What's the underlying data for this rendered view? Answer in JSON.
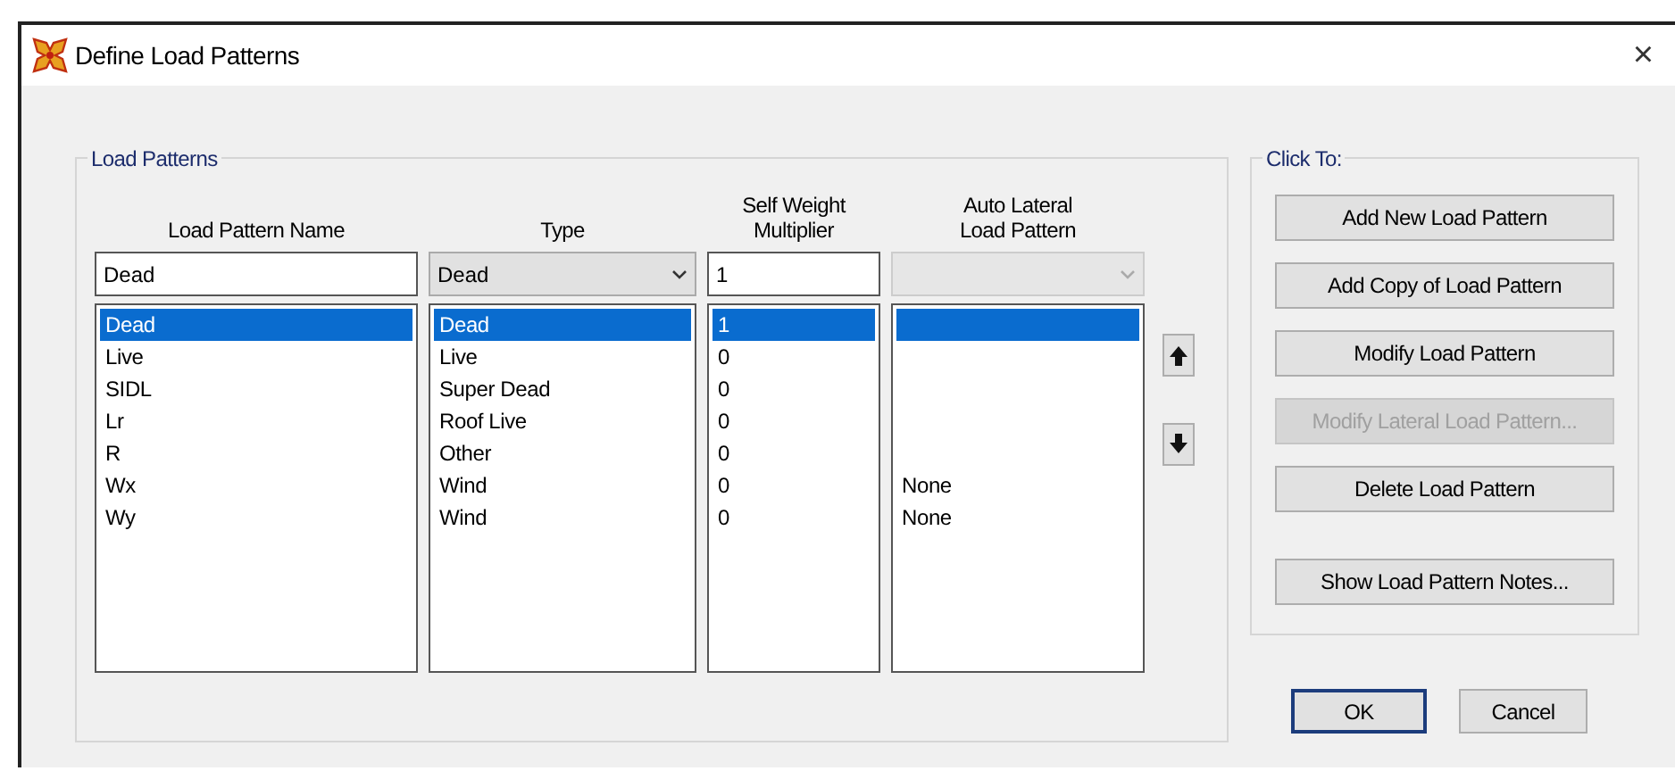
{
  "window": {
    "title": "Define Load Patterns",
    "close_glyph": "×"
  },
  "load_patterns": {
    "title": "Load Patterns",
    "columns": [
      "Load Pattern Name",
      "Type",
      "Self Weight Multiplier",
      "Auto Lateral Load Pattern"
    ],
    "edit_row": {
      "name": "Dead",
      "type": "Dead",
      "multiplier": "1",
      "auto_lateral": {
        "disabled": true
      }
    },
    "rows": [
      {
        "name": "Dead",
        "type": "Dead",
        "multiplier": "1",
        "selected": true
      },
      {
        "name": "Live",
        "type": "Live",
        "multiplier": "0",
        "selected": false
      },
      {
        "name": "SIDL",
        "type": "Super Dead",
        "multiplier": "0",
        "selected": false
      },
      {
        "name": "Lr",
        "type": "Roof Live",
        "multiplier": "0",
        "selected": false
      },
      {
        "name": "R",
        "type": "Other",
        "multiplier": "0",
        "selected": false
      },
      {
        "name": "Wx",
        "type": "Wind",
        "multiplier": "0",
        "auto_lateral": "None",
        "selected": false
      },
      {
        "name": "Wy",
        "type": "Wind",
        "multiplier": "0",
        "auto_lateral": "None",
        "selected": false
      }
    ]
  },
  "click_to": {
    "title": "Click To:",
    "buttons": [
      {
        "label": "Add New Load Pattern",
        "disabled": false
      },
      {
        "label": "Add Copy of Load Pattern",
        "disabled": false
      },
      {
        "label": "Modify Load Pattern",
        "disabled": false
      },
      {
        "label": "Modify Lateral Load Pattern...",
        "disabled": true
      },
      {
        "label": "Delete Load Pattern",
        "disabled": false
      },
      {
        "label": "Show Load Pattern Notes...",
        "disabled": false
      }
    ]
  },
  "footer_buttons": [
    {
      "label": "OK",
      "default": true
    },
    {
      "label": "Cancel",
      "default": false
    }
  ]
}
